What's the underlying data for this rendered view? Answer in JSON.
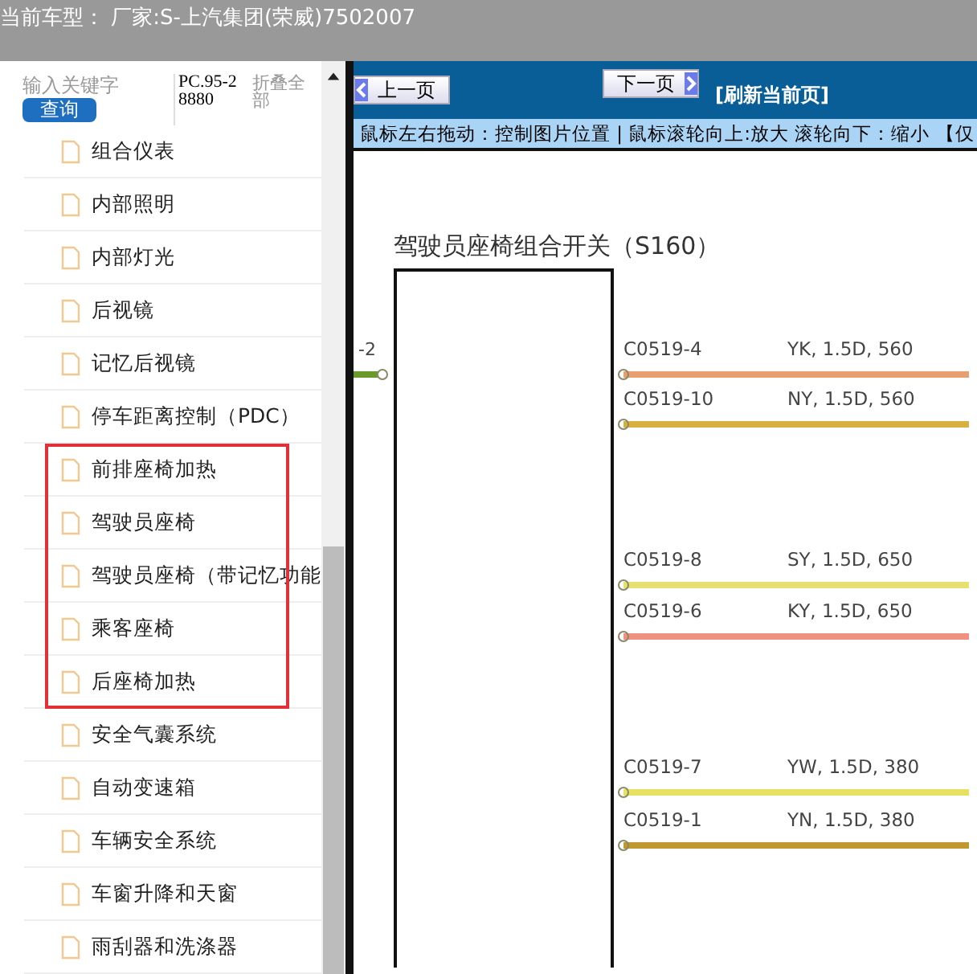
{
  "header": {
    "title": "当前车型： 厂家:S-上汽集团(荣威)7502007"
  },
  "sidebar": {
    "search": {
      "placeholder": "输入关键字"
    },
    "search_button": "查询",
    "code": "PC.95-28880",
    "collapse_all": "折叠全部",
    "items": [
      {
        "label": "组合仪表",
        "highlighted": false
      },
      {
        "label": "内部照明",
        "highlighted": false
      },
      {
        "label": "内部灯光",
        "highlighted": false
      },
      {
        "label": "后视镜",
        "highlighted": false
      },
      {
        "label": "记忆后视镜",
        "highlighted": false
      },
      {
        "label": "停车距离控制（PDC）",
        "highlighted": false
      },
      {
        "label": "前排座椅加热",
        "highlighted": true
      },
      {
        "label": "驾驶员座椅",
        "highlighted": true
      },
      {
        "label": "驾驶员座椅（带记忆功能",
        "highlighted": true
      },
      {
        "label": "乘客座椅",
        "highlighted": true
      },
      {
        "label": "后座椅加热",
        "highlighted": true
      },
      {
        "label": "安全气囊系统",
        "highlighted": false
      },
      {
        "label": "自动变速箱",
        "highlighted": false
      },
      {
        "label": "车辆安全系统",
        "highlighted": false
      },
      {
        "label": "车窗升降和天窗",
        "highlighted": false
      },
      {
        "label": "雨刮器和洗涤器",
        "highlighted": false
      }
    ]
  },
  "viewer": {
    "prev_button": "上一页",
    "next_button": "下一页",
    "refresh_link": "[刷新当前页]",
    "hint": "鼠标左右拖动：控制图片位置 | 鼠标滚轮向上:放大  滚轮向下：缩小 【仅",
    "diagram": {
      "title": "驾驶员座椅组合开关（S160）",
      "left_wire": {
        "label": "-2",
        "color": "#6a9a2a"
      },
      "wires": [
        {
          "connector": "C0519-4",
          "spec": "YK, 1.5D, 560",
          "color": "#e8a070"
        },
        {
          "connector": "C0519-10",
          "spec": "NY, 1.5D, 560",
          "color": "#d8b040"
        },
        {
          "connector": "C0519-8",
          "spec": "SY, 1.5D, 650",
          "color": "#e8e070"
        },
        {
          "connector": "C0519-6",
          "spec": "KY, 1.5D, 650",
          "color": "#f09080"
        },
        {
          "connector": "C0519-7",
          "spec": "YW, 1.5D, 380",
          "color": "#e8e060"
        },
        {
          "connector": "C0519-1",
          "spec": "YN, 1.5D, 380",
          "color": "#c09830"
        }
      ]
    }
  }
}
